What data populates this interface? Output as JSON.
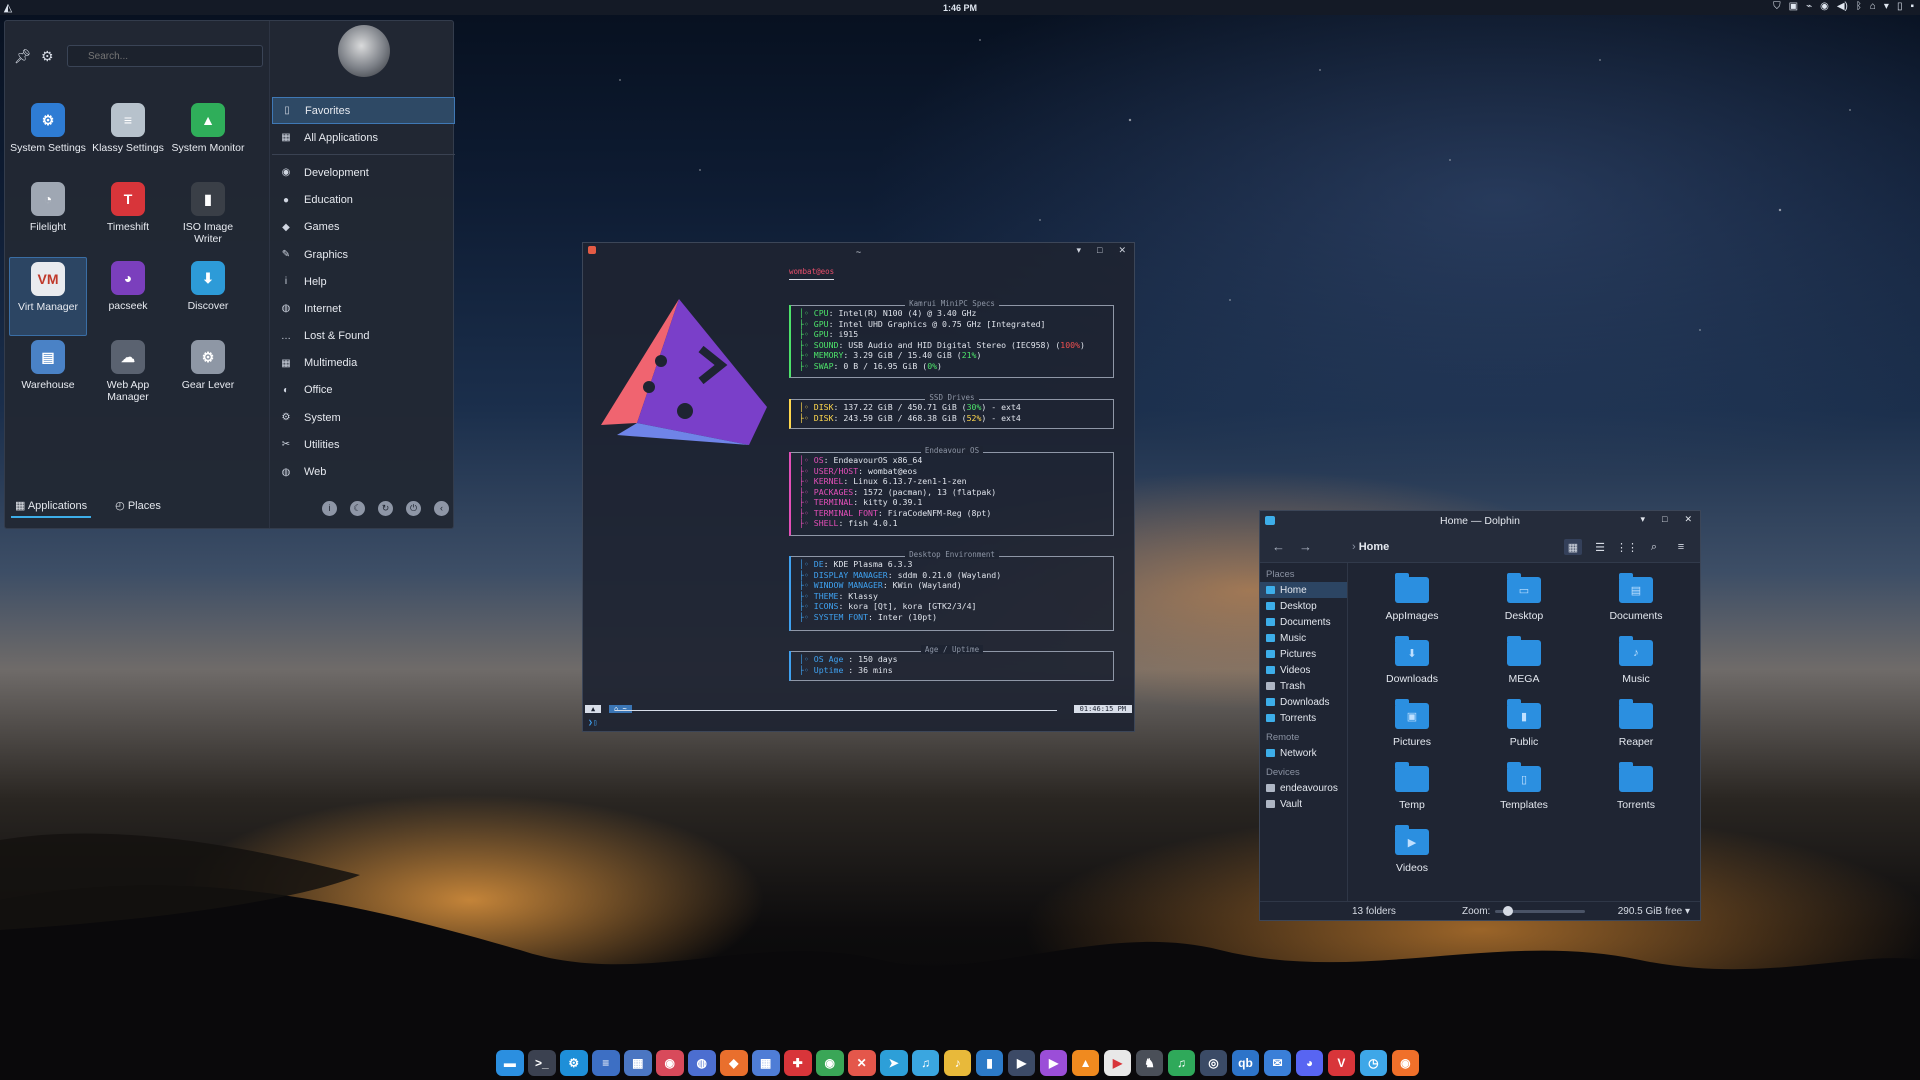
{
  "topbar": {
    "clock": "1:46 PM"
  },
  "menu": {
    "search_placeholder": "Search...",
    "favorites": [
      {
        "label": "System Settings",
        "icon": "system-settings-icon",
        "color": "#2e7cd4",
        "glyph": "⚙"
      },
      {
        "label": "Klassy Settings",
        "icon": "klassy-settings-icon",
        "color": "#b7c2cc",
        "glyph": "≡"
      },
      {
        "label": "System Monitor",
        "icon": "system-monitor-icon",
        "color": "#2fae5a",
        "glyph": "▲"
      },
      {
        "label": "Filelight",
        "icon": "filelight-icon",
        "color": "#9fa7b3",
        "glyph": "◔"
      },
      {
        "label": "Timeshift",
        "icon": "timeshift-icon",
        "color": "#d8353a",
        "glyph": "T"
      },
      {
        "label": "ISO Image Writer",
        "icon": "iso-image-writer-icon",
        "color": "#3a3f47",
        "glyph": "▮"
      },
      {
        "label": "Virt Manager",
        "icon": "virt-manager-icon",
        "color": "#e9ebef",
        "glyph": "VM"
      },
      {
        "label": "pacseek",
        "icon": "pacseek-icon",
        "color": "#7b3fbd",
        "glyph": "◕"
      },
      {
        "label": "Discover",
        "icon": "discover-icon",
        "color": "#2d9bd8",
        "glyph": "⬇"
      },
      {
        "label": "Warehouse",
        "icon": "warehouse-icon",
        "color": "#4a82c6",
        "glyph": "▤"
      },
      {
        "label": "Web App Manager",
        "icon": "web-app-manager-icon",
        "color": "#5a6270",
        "glyph": "☁"
      },
      {
        "label": "Gear Lever",
        "icon": "gear-lever-icon",
        "color": "#8e97a5",
        "glyph": "⚙"
      }
    ],
    "selected_favorite": "Virt Manager",
    "categories": [
      {
        "label": "Favorites",
        "icon": "bookmark-icon",
        "glyph": "▯"
      },
      {
        "label": "All Applications",
        "icon": "all-applications-icon",
        "glyph": "▦"
      },
      {
        "label": "Development",
        "icon": "development-icon",
        "glyph": "◉"
      },
      {
        "label": "Education",
        "icon": "education-icon",
        "glyph": "●"
      },
      {
        "label": "Games",
        "icon": "games-icon",
        "glyph": "◆"
      },
      {
        "label": "Graphics",
        "icon": "graphics-icon",
        "glyph": "✎"
      },
      {
        "label": "Help",
        "icon": "help-icon",
        "glyph": "i"
      },
      {
        "label": "Internet",
        "icon": "internet-icon",
        "glyph": "◍"
      },
      {
        "label": "Lost & Found",
        "icon": "lost-found-icon",
        "glyph": "…"
      },
      {
        "label": "Multimedia",
        "icon": "multimedia-icon",
        "glyph": "▦"
      },
      {
        "label": "Office",
        "icon": "office-icon",
        "glyph": "◐"
      },
      {
        "label": "System",
        "icon": "system-icon",
        "glyph": "⚙"
      },
      {
        "label": "Utilities",
        "icon": "utilities-icon",
        "glyph": "✂"
      },
      {
        "label": "Web",
        "icon": "web-icon",
        "glyph": "◍"
      }
    ],
    "tabs": {
      "applications": "Applications",
      "places": "Places"
    }
  },
  "terminal": {
    "title": "~",
    "user_host": "wombat@eos",
    "specs": {
      "header": "Kamrui MiniPC Specs",
      "lines": [
        {
          "key": "CPU",
          "val": ": Intel(R) N100 (4) @ 3.40 GHz"
        },
        {
          "key": "GPU",
          "val": ": Intel UHD Graphics @ 0.75 GHz [Integrated]"
        },
        {
          "key": "GPU",
          "val": ": i915"
        },
        {
          "key": "SOUND",
          "val": ": USB Audio and HID Digital Stereo (IEC958) (",
          "pct": "100%",
          "tail": ")"
        },
        {
          "key": "MEMORY",
          "val": ": 3.29 GiB / 15.40 GiB (",
          "pct": "21%",
          "tail": ")"
        },
        {
          "key": "SWAP",
          "val": ": 0 B / 16.95 GiB (",
          "pct": "0%",
          "tail": ")"
        }
      ]
    },
    "drives": {
      "header": "SSD Drives",
      "lines": [
        {
          "key": "DISK",
          "val": ": 137.22 GiB / 450.71 GiB (",
          "pct": "30%",
          "tail": ") - ext4"
        },
        {
          "key": "DISK",
          "val": ": 243.59 GiB / 468.38 GiB (",
          "pct": "52%",
          "tail": ") - ext4"
        }
      ]
    },
    "os": {
      "header": "Endeavour OS",
      "lines": [
        {
          "key": "OS",
          "val": ": EndeavourOS x86_64"
        },
        {
          "key": "USER/HOST",
          "val": ": wombat@eos"
        },
        {
          "key": "KERNEL",
          "val": ": Linux 6.13.7-zen1-1-zen"
        },
        {
          "key": "PACKAGES",
          "val": ": 1572 (pacman), 13 (flatpak)"
        },
        {
          "key": "TERMINAL",
          "val": ": kitty 0.39.1"
        },
        {
          "key": "TERMINAL FONT",
          "val": ": FiraCodeNFM-Reg (8pt)"
        },
        {
          "key": "SHELL",
          "val": ": fish 4.0.1"
        }
      ]
    },
    "de": {
      "header": "Desktop Environment",
      "lines": [
        {
          "key": "DE",
          "val": ": KDE Plasma 6.3.3"
        },
        {
          "key": "DISPLAY MANAGER",
          "val": ": sddm 0.21.0 (Wayland)"
        },
        {
          "key": "WINDOW MANAGER",
          "val": ": KWin (Wayland)"
        },
        {
          "key": "THEME",
          "val": ": Klassy"
        },
        {
          "key": "ICONS",
          "val": ": kora [Qt], kora [GTK2/3/4]"
        },
        {
          "key": "SYSTEM FONT",
          "val": ": Inter (10pt)"
        }
      ]
    },
    "age": {
      "header": "Age / Uptime",
      "lines": [
        {
          "key": "OS Age",
          "val": "  : 150 days"
        },
        {
          "key": "Uptime",
          "val": "  : 36 mins"
        }
      ]
    },
    "prompt_dir": "~",
    "prompt_time": "01:46:15 PM"
  },
  "dolphin": {
    "title": "Home — Dolphin",
    "breadcrumb": "Home",
    "sidebar": {
      "places_label": "Places",
      "places": [
        "Home",
        "Desktop",
        "Documents",
        "Music",
        "Pictures",
        "Videos",
        "Trash",
        "Downloads",
        "Torrents"
      ],
      "remote_label": "Remote",
      "remote": [
        "Network"
      ],
      "devices_label": "Devices",
      "devices": [
        "endeavouros",
        "Vault"
      ]
    },
    "folders": [
      {
        "label": "AppImages",
        "glyph": ""
      },
      {
        "label": "Desktop",
        "glyph": "▭"
      },
      {
        "label": "Documents",
        "glyph": "▤"
      },
      {
        "label": "Downloads",
        "glyph": "⬇"
      },
      {
        "label": "MEGA",
        "glyph": ""
      },
      {
        "label": "Music",
        "glyph": "♪"
      },
      {
        "label": "Pictures",
        "glyph": "▣"
      },
      {
        "label": "Public",
        "glyph": "▮"
      },
      {
        "label": "Reaper",
        "glyph": ""
      },
      {
        "label": "Temp",
        "glyph": ""
      },
      {
        "label": "Templates",
        "glyph": "▯"
      },
      {
        "label": "Torrents",
        "glyph": ""
      },
      {
        "label": "Videos",
        "glyph": "▶"
      }
    ],
    "status_count": "13 folders",
    "zoom_label": "Zoom:",
    "zoom_level": 0.1,
    "free_space": "290.5 GiB free"
  },
  "dock": [
    {
      "icon": "dolphin-icon",
      "color": "#2b8fe0",
      "glyph": "▬"
    },
    {
      "icon": "terminal-icon",
      "color": "#3b4150",
      "glyph": ">_"
    },
    {
      "icon": "system-settings-icon",
      "color": "#1e8fd8",
      "glyph": "⚙"
    },
    {
      "icon": "kate-icon",
      "color": "#3d6fc4",
      "glyph": "≡"
    },
    {
      "icon": "archive-icon",
      "color": "#4b76c2",
      "glyph": "▦"
    },
    {
      "icon": "vivaldi-icon",
      "color": "#d84a5b",
      "glyph": "◉"
    },
    {
      "icon": "browser-icon",
      "color": "#4c6ed0",
      "glyph": "◍"
    },
    {
      "icon": "app-icon",
      "color": "#e96f2d",
      "glyph": "◆"
    },
    {
      "icon": "grid-app-icon",
      "color": "#4f7dd6",
      "glyph": "▦"
    },
    {
      "icon": "red-app-icon",
      "color": "#d8353a",
      "glyph": "✚"
    },
    {
      "icon": "chrome-icon",
      "color": "#3aa657",
      "glyph": "◉"
    },
    {
      "icon": "tool-icon",
      "color": "#e4574b",
      "glyph": "✕"
    },
    {
      "icon": "telegram-icon",
      "color": "#2d9fd8",
      "glyph": "➤"
    },
    {
      "icon": "music-icon",
      "color": "#3aa6e0",
      "glyph": "♫"
    },
    {
      "icon": "music-notes-icon",
      "color": "#e8b93a",
      "glyph": "♪"
    },
    {
      "icon": "bar-icon",
      "color": "#2c7ac7",
      "glyph": "▮"
    },
    {
      "icon": "kdenlive-icon",
      "color": "#3c4a66",
      "glyph": "▶"
    },
    {
      "icon": "player-icon",
      "color": "#9b4ed8",
      "glyph": "▶"
    },
    {
      "icon": "vlc-icon",
      "color": "#f08a1f",
      "glyph": "▲"
    },
    {
      "icon": "youtube-icon",
      "color": "#e8e8e8",
      "glyph": "▶"
    },
    {
      "icon": "gnu-icon",
      "color": "#4a4f58",
      "glyph": "♞"
    },
    {
      "icon": "spotify-icon",
      "color": "#2fa95a",
      "glyph": "♫"
    },
    {
      "icon": "steam-icon",
      "color": "#3b4b66",
      "glyph": "◎"
    },
    {
      "icon": "qbittorrent-icon",
      "color": "#2d74c9",
      "glyph": "qb"
    },
    {
      "icon": "thunderbird-icon",
      "color": "#3a7fd8",
      "glyph": "✉"
    },
    {
      "icon": "discord-icon",
      "color": "#5865f2",
      "glyph": "◕"
    },
    {
      "icon": "vivaldi-red-icon",
      "color": "#d8353a",
      "glyph": "V"
    },
    {
      "icon": "safari-icon",
      "color": "#3ea7e8",
      "glyph": "◷"
    },
    {
      "icon": "firefox-icon",
      "color": "#f0702a",
      "glyph": "◉"
    }
  ],
  "colors": {
    "accent": "#3daee9",
    "terminal_green": "#4de36a",
    "terminal_yellow": "#ffd84d",
    "terminal_pink": "#e34fb8",
    "terminal_blue": "#3fa1f0",
    "terminal_red": "#f05050"
  }
}
